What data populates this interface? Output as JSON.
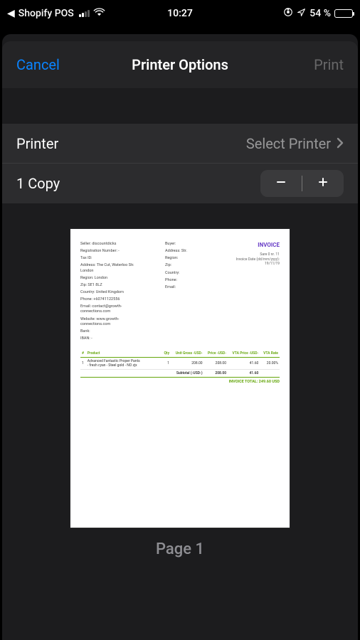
{
  "status_bar": {
    "return_app": "Shopify POS",
    "time": "10:27",
    "battery_text": "54 %",
    "battery_pct": 54
  },
  "nav": {
    "cancel": "Cancel",
    "title": "Printer Options",
    "print": "Print"
  },
  "rows": {
    "printer_label": "Printer",
    "printer_value": "Select Printer",
    "copies_label": "1 Copy"
  },
  "preview": {
    "page_label": "Page 1",
    "invoice": {
      "title": "INVOICE",
      "sub": "Sare 0 nr. 11\nInvoice Date (dd/mm/yyyy):\n19/11/19",
      "seller": {
        "s1": "Seller: discountdicks",
        "s2": "Registration Number: -",
        "s3": "Tax ID:",
        "s4": "Address: The Cut, Waterloo Str.\nLondon",
        "s5": "Region: London",
        "s6": "Zip: SE1 8LZ",
        "s7": "Country: United Kingdom",
        "s8": "Phone: +60741122556",
        "s9": "Email: contact@growth-\nconnections.com",
        "s10": "Website: www.growth-\nconnections.com",
        "s11": "Bank:",
        "s12": "IBAN: -"
      },
      "buyer": {
        "b1": "Buyer:",
        "b2": "Address: Str.",
        "b3": "Region:",
        "b4": "Zip:",
        "b5": "Country:",
        "b6": "Phone:",
        "b7": "Email:"
      },
      "table": {
        "h0": "#",
        "h1": "Product",
        "h2": "Qty",
        "h3": "Unit Gross\n-USD-",
        "h4": "Price\n-USD-",
        "h5": "VTA Price\n-USD-",
        "h6": "VTA Rate",
        "r1": {
          "n": "1",
          "prod": "Advanced Fantastic Proper Pants\n- fresh cyan - Steel gold - NO zjx",
          "qty": "1",
          "unit": "208.00",
          "price": "208.00",
          "vta": "41.60",
          "rate": "20.00%"
        },
        "sub_label": "Subtotal (-USD-)",
        "sub_price": "208.00",
        "sub_vta": "41.60",
        "total": "INVOICE TOTAL: 249.60 USD"
      }
    }
  }
}
